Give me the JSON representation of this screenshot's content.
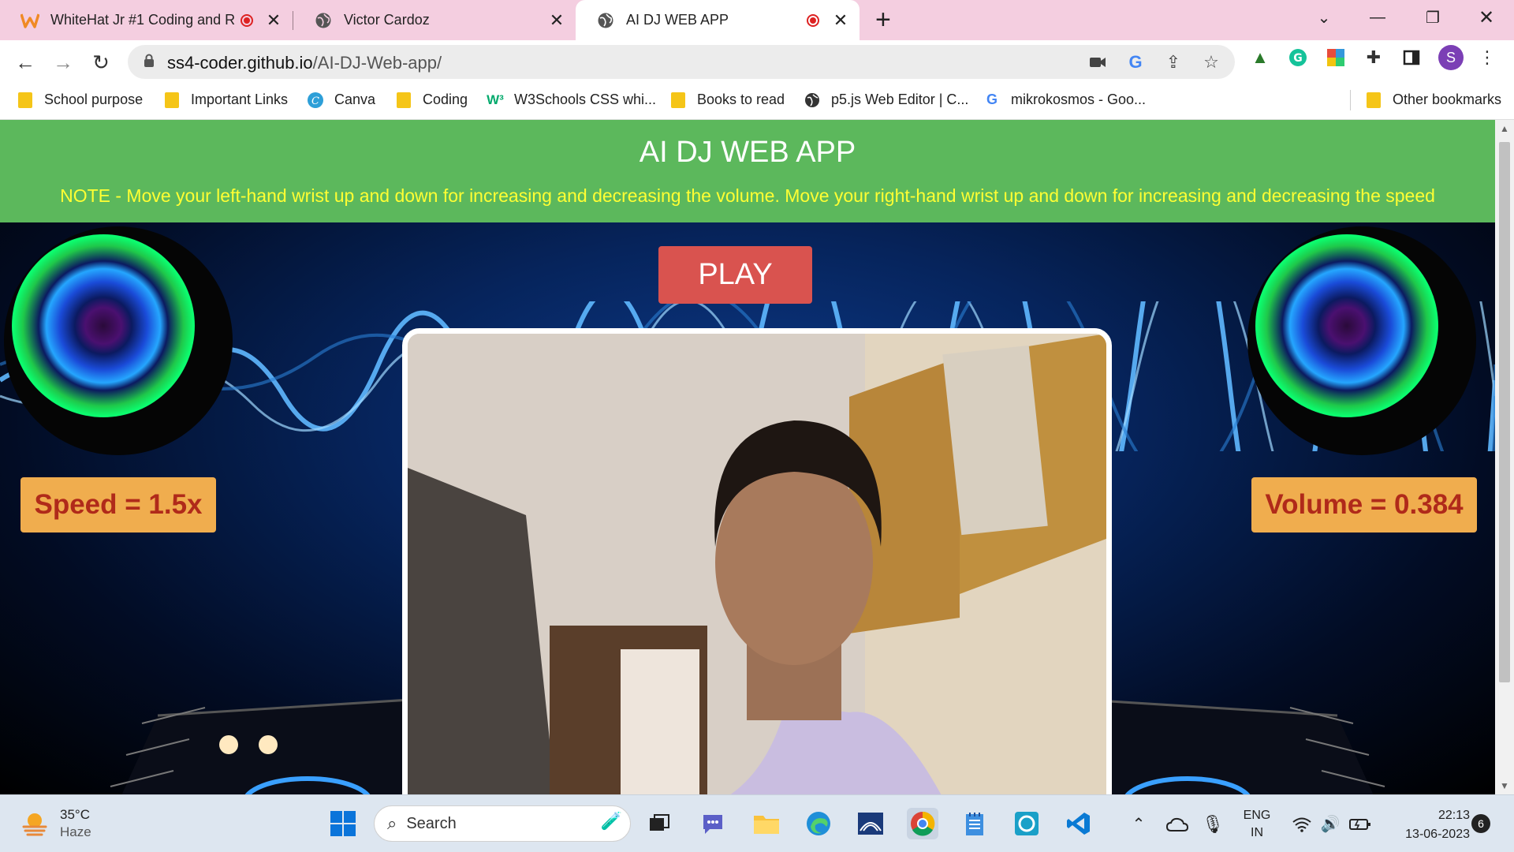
{
  "tabs": [
    {
      "title": "WhiteHat Jr #1 Coding and R",
      "recording": true
    },
    {
      "title": "Victor Cardoz",
      "recording": false
    },
    {
      "title": "AI DJ WEB APP",
      "recording": true
    }
  ],
  "address": {
    "url_domain": "ss4-coder.github.io",
    "url_path": "/AI-DJ-Web-app/"
  },
  "profile_initial": "S",
  "bookmarks": [
    {
      "label": "School purpose",
      "icon": "folder-icon"
    },
    {
      "label": "Important Links",
      "icon": "folder-icon"
    },
    {
      "label": "Canva",
      "icon": "canva-icon"
    },
    {
      "label": "Coding",
      "icon": "folder-icon"
    },
    {
      "label": "W3Schools CSS whi...",
      "icon": "w3schools-icon"
    },
    {
      "label": "Books to read",
      "icon": "folder-icon"
    },
    {
      "label": "p5.js Web Editor | C...",
      "icon": "globe-icon"
    },
    {
      "label": "mikrokosmos - Goo...",
      "icon": "google-icon"
    },
    {
      "label": "Other bookmarks",
      "icon": "folder-icon"
    }
  ],
  "app": {
    "title": "AI DJ WEB APP",
    "note": "NOTE - Move your left-hand wrist up and down for increasing and decreasing the volume. Move your right-hand wrist up and down for increasing and decreasing the speed",
    "play_label": "PLAY",
    "speed_text": "Speed = 1.5x",
    "volume_text": "Volume = 0.384"
  },
  "taskbar": {
    "temperature": "35°C",
    "condition": "Haze",
    "search_label": "Search",
    "language": "ENG",
    "region": "IN",
    "time": "22:13",
    "date": "13-06-2023",
    "notifications": "6"
  },
  "colors": {
    "header_green": "#5cb85c",
    "note_yellow": "#ffff33",
    "play_red": "#d9534f",
    "badge_orange": "#f0ad4e",
    "badge_text": "#b02a1a"
  }
}
